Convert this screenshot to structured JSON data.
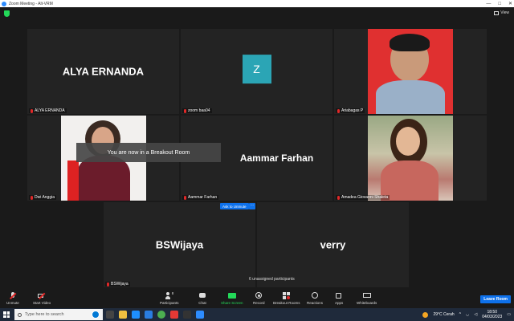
{
  "window": {
    "title": "Zoom Meeting - Alt-VRM",
    "view_label": "View",
    "controls": [
      "—",
      "□",
      "✕"
    ]
  },
  "tiles": [
    {
      "id": "alya",
      "display_name": "ALYA ERNANDA",
      "label": "ALYA ERNANDA"
    },
    {
      "id": "zoom",
      "avatar_letter": "Z",
      "label": "zoom baa04"
    },
    {
      "id": "ariabagas",
      "label": "Ariabagas P"
    },
    {
      "id": "dwi",
      "label": "Dwi Anggia"
    },
    {
      "id": "aammar",
      "display_name": "Aammar Farhan",
      "label": "Aammar Farhan"
    },
    {
      "id": "amadea",
      "label": "Amadea Giovanni Shaleta"
    },
    {
      "id": "bswijaya",
      "display_name": "BSWijaya",
      "label": "BSWijaya"
    },
    {
      "id": "verry",
      "display_name": "verry"
    }
  ],
  "notice": "You are now in a Breakout Room",
  "ask_to_unmute": "Ask to Unmute",
  "more_button": "···",
  "unassigned": "6 unassigned participants",
  "toolbar": {
    "unmute": "Unmute",
    "start_video": "Start Video",
    "participants": "Participants",
    "participants_count": "8",
    "chat": "Chat",
    "share_screen": "Share Screen",
    "record": "Record",
    "breakout_rooms": "Breakout Rooms",
    "reactions": "Reactions",
    "apps": "Apps",
    "whiteboards": "Whiteboards",
    "leave": "Leave Room"
  },
  "taskbar": {
    "search_placeholder": "Type here to search",
    "weather": "29°C Cerah",
    "time": "18:50",
    "date": "04/03/2023"
  },
  "colors": {
    "accent": "#0e71eb",
    "share_green": "#23d959",
    "muted_red": "#e02828",
    "tile_bg": "#232323",
    "avatar_teal": "#2ba5b5"
  }
}
